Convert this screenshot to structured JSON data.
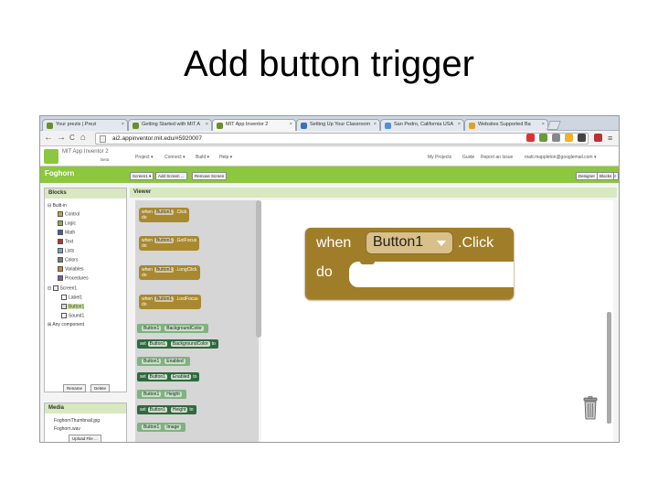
{
  "slide": {
    "title": "Add button trigger"
  },
  "browser": {
    "tabs": [
      {
        "label": "Your prezis | Prezi",
        "active": false
      },
      {
        "label": "Getting Started with MIT A",
        "active": false
      },
      {
        "label": "MIT App Inventor 2",
        "active": true
      },
      {
        "label": "Setting Up Your Classroom",
        "active": false
      },
      {
        "label": "San Pedro, California USA",
        "active": false
      },
      {
        "label": "Websites Supported Ba",
        "active": false
      }
    ],
    "url": "ai2.appinventor.mit.edu/#5920007",
    "nav": {
      "back": "←",
      "forward": "→",
      "reload": "C",
      "home": "⌂"
    }
  },
  "app": {
    "title": "MIT App Inventor 2",
    "beta": "Beta",
    "menus": [
      "Project ▾",
      "Connect ▾",
      "Build ▾",
      "Help ▾"
    ],
    "right_menus": [
      "My Projects",
      "Guide",
      "Report an Issue",
      "matt.mappleton@googlemail.com ▾"
    ],
    "project_name": "Foghorn",
    "screen_buttons": [
      "Screen1 ▾",
      "Add Screen ...",
      "Remove Screen"
    ],
    "mode_buttons": [
      "Designer",
      "Blocks"
    ]
  },
  "blocks_panel": {
    "header": "Blocks",
    "builtin_label": "Built-in",
    "builtin": [
      {
        "label": "Control",
        "color": "#c9a23c"
      },
      {
        "label": "Logic",
        "color": "#8ab04a"
      },
      {
        "label": "Math",
        "color": "#3c5fa8"
      },
      {
        "label": "Text",
        "color": "#b8342b"
      },
      {
        "label": "Lists",
        "color": "#74a4c9"
      },
      {
        "label": "Colors",
        "color": "#7a7a7a"
      },
      {
        "label": "Variables",
        "color": "#d1822a"
      },
      {
        "label": "Procedures",
        "color": "#7b5ba8"
      }
    ],
    "screen_label": "Screen1",
    "components": [
      "Label1",
      "Button1",
      "Sound1"
    ],
    "any_component": "Any component",
    "rename": "Rename",
    "delete": "Delete"
  },
  "media_panel": {
    "header": "Media",
    "items": [
      "FoghornThumbnail.jpg",
      "Foghorn.wav"
    ],
    "upload": "Upload File ..."
  },
  "viewer": {
    "header": "Viewer"
  },
  "drawer": {
    "event_blocks": [
      {
        "when": "when",
        "component": "Button1",
        "event": ".Click",
        "do": "do"
      },
      {
        "when": "when",
        "component": "Button1",
        "event": ".GotFocus",
        "do": "do"
      },
      {
        "when": "when",
        "component": "Button1",
        "event": ".LongClick",
        "do": "do"
      },
      {
        "when": "when",
        "component": "Button1",
        "event": ".LostFocus",
        "do": "do"
      }
    ],
    "property_blocks": [
      {
        "prefix": "",
        "component": "Button1",
        "property": "BackgroundColor",
        "suffix": "",
        "dark": false
      },
      {
        "prefix": "set",
        "component": "Button1",
        "property": "BackgroundColor",
        "suffix": "to",
        "dark": true
      },
      {
        "prefix": "",
        "component": "Button1",
        "property": "Enabled",
        "suffix": "",
        "dark": false
      },
      {
        "prefix": "set",
        "component": "Button1",
        "property": "Enabled",
        "suffix": "to",
        "dark": true
      },
      {
        "prefix": "",
        "component": "Button1",
        "property": "Height",
        "suffix": "",
        "dark": false
      },
      {
        "prefix": "set",
        "component": "Button1",
        "property": "Height",
        "suffix": "to",
        "dark": true
      },
      {
        "prefix": "",
        "component": "Button1",
        "property": "Image",
        "suffix": "",
        "dark": false
      }
    ]
  },
  "workspace_block": {
    "when": "when",
    "component": "Button1",
    "event": ".Click",
    "do": "do"
  },
  "icons": {
    "trash": "trash-can-icon"
  }
}
